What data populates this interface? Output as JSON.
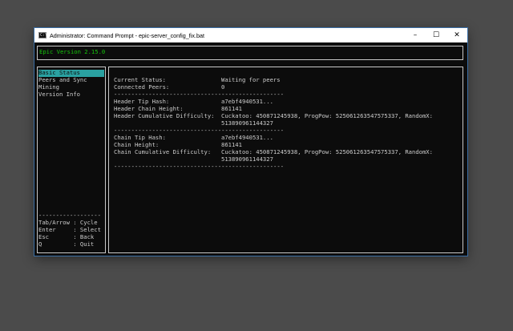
{
  "window": {
    "title": "Administrator: Command Prompt - epic-server_config_fix.bat",
    "icon_label": "C:\\",
    "min_glyph": "–",
    "max_glyph": "☐",
    "close_glyph": "✕"
  },
  "header": {
    "version": "Epic Version 2.15.0"
  },
  "menu": {
    "items": [
      "Basic Status",
      "Peers and Sync",
      "Mining",
      "Version Info"
    ],
    "selected_index": 0,
    "divider": "------------------",
    "help": [
      "Tab/Arrow : Cycle",
      "Enter     : Select",
      "Esc       : Back",
      "Q         : Quit"
    ]
  },
  "status": {
    "current_status_label": "Current Status:",
    "current_status_value": "Waiting for peers",
    "connected_peers_label": "Connected Peers:",
    "connected_peers_value": "0",
    "divider": "-------------------------------------------------",
    "header_tip_hash_label": "Header Tip Hash:",
    "header_tip_hash_value": "a7ebf4940531...",
    "header_chain_height_label": "Header Chain Height:",
    "header_chain_height_value": "861141",
    "header_difficulty_label": "Header Cumulative Difficulty:",
    "header_difficulty_value_1": "Cuckatoo: 450871245938, ProgPow: 525061263547575337, RandomX:",
    "header_difficulty_value_2": "513890961144327",
    "chain_tip_hash_label": "Chain Tip Hash:",
    "chain_tip_hash_value": "a7ebf4940531...",
    "chain_height_label": "Chain Height:",
    "chain_height_value": "861141",
    "chain_difficulty_label": "Chain Cumulative Difficulty:",
    "chain_difficulty_value_1": "Cuckatoo: 450871245938, ProgPow: 525061263547575337, RandomX:",
    "chain_difficulty_value_2": "513890961144327"
  }
}
